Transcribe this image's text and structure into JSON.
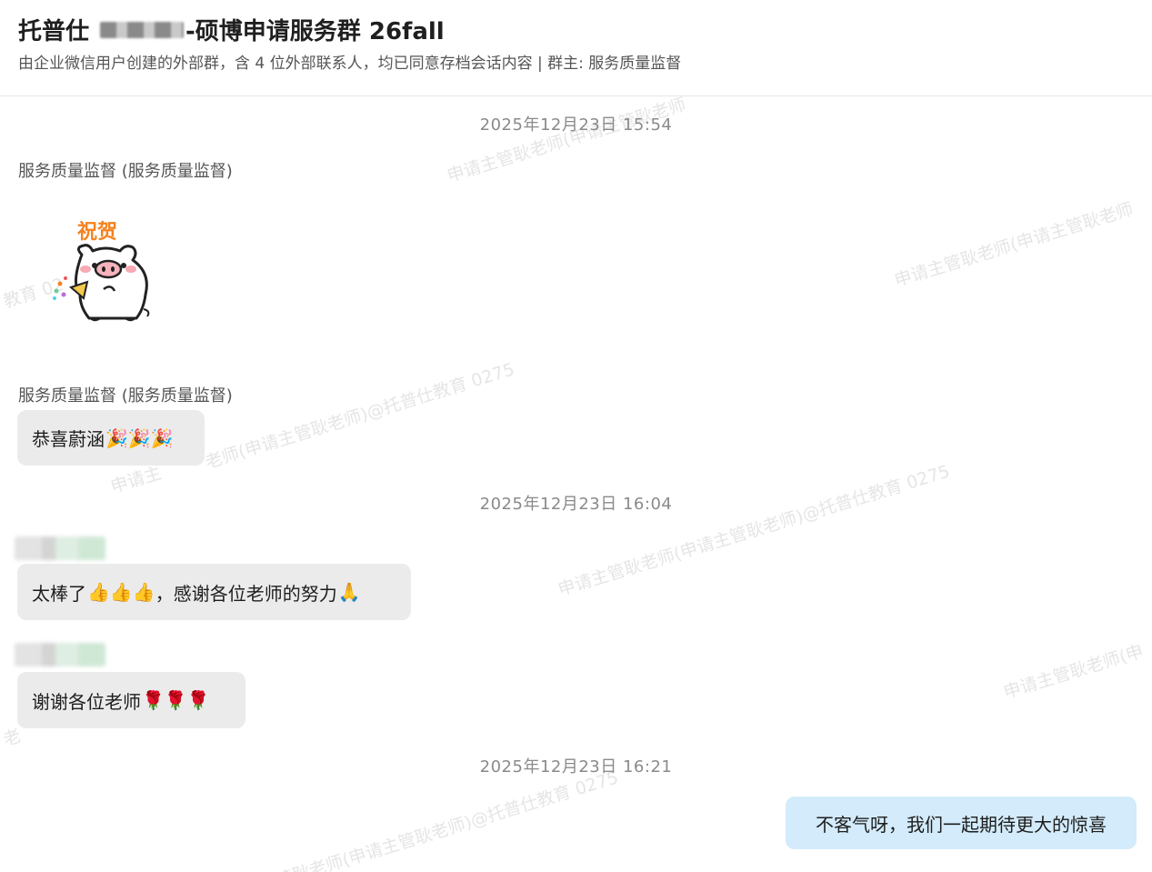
{
  "header": {
    "title_prefix": "托普仕",
    "title_suffix": "-硕博申请服务群 26fall",
    "subtitle": "由企业微信用户创建的外部群，含 4 位外部联系人，均已同意存档会话内容 | 群主: 服务质量监督"
  },
  "messages": {
    "ts1": "2025年12月23日 15:54",
    "sender1": "服务质量监督 (服务质量监督)",
    "sender2": "服务质量监督 (服务质量监督)",
    "msg2": "恭喜蔚涵",
    "msg2_emoji": "🎉🎉🎉",
    "ts2": "2025年12月23日 16:04",
    "msg3_a": "太棒了",
    "msg3_emoji": "👍👍👍",
    "msg3_b": "，感谢各位老师的努力",
    "msg3_emoji2": "🙏",
    "msg4": "谢谢各位老师",
    "msg4_emoji": "🌹🌹🌹",
    "ts3": "2025年12月23日 16:21",
    "msg5": "不客气呀，我们一起期待更大的惊喜"
  },
  "sticker": {
    "label": "祝贺",
    "icon": "pig-celebrate-sticker"
  },
  "watermark": {
    "w1": "申请主管耿老师(申请主管耿老师",
    "w2": "申请主管耿老师(申请主管耿老师",
    "w3": "教育 02",
    "w4": "老师(申请主管耿老师)@托普仕教育 0275",
    "w5": "申请主",
    "w6": "申请主管耿老师(申请主管耿老师)@托普仕教育 0275",
    "w7": "申请主管耿老师(申",
    "w8": "老",
    "w9": "管耿老师(申请主管耿老师)@托普仕教育 0275"
  },
  "colors": {
    "bubble_left": "#ebebeb",
    "bubble_right": "#d3ebfa",
    "sticker_text": "#f5821f"
  }
}
